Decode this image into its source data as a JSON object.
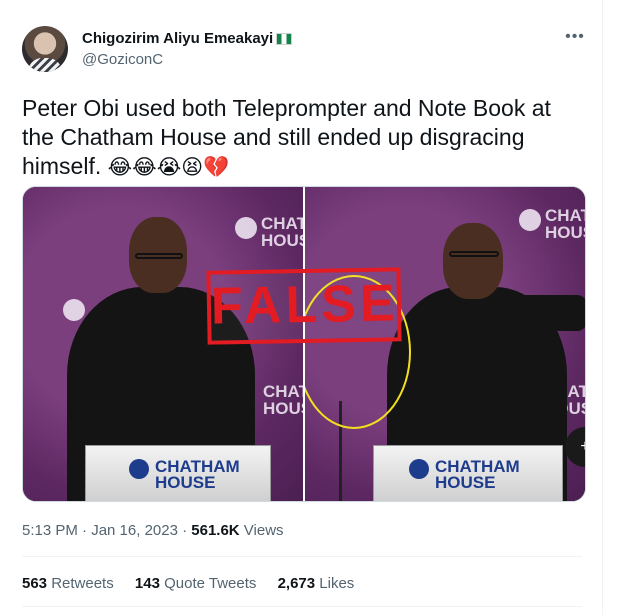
{
  "author": {
    "name": "Chigozirim Aliyu Emeakayi",
    "handle": "@GoziconC",
    "flag_icon": "nigeria-flag"
  },
  "tweet": {
    "text": "Peter Obi used both Teleprompter and Note Book at the Chatham House and still ended up disgracing himself.",
    "emojis": "😂😂😭😫💔"
  },
  "media": {
    "stamp_label": "FALSE",
    "backdrop_top": "CHAT\nHOUS",
    "backdrop_top_right": "CHAT\nHOUS",
    "backdrop_mid": "CHAT\nHOUS",
    "backdrop_mid_right": "CHAT\nHOUS",
    "lectern_left_line1": "CHATHAM",
    "lectern_left_line2": "HOUSE",
    "lectern_right_line1": "CHATHAM",
    "lectern_right_line2": "HOUSE",
    "overflow_label": "+"
  },
  "meta": {
    "time": "5:13 PM · Jan 16, 2023 · ",
    "views_count": "561.6K",
    "views_label": " Views"
  },
  "stats": {
    "retweets_count": "563",
    "retweets_label": " Retweets",
    "quotes_count": "143",
    "quotes_label": " Quote Tweets",
    "likes_count": "2,673",
    "likes_label": " Likes"
  },
  "colors": {
    "stamp": "#e31b23",
    "backdrop": "#5d2862",
    "highlight_circle": "#f2e01c"
  }
}
